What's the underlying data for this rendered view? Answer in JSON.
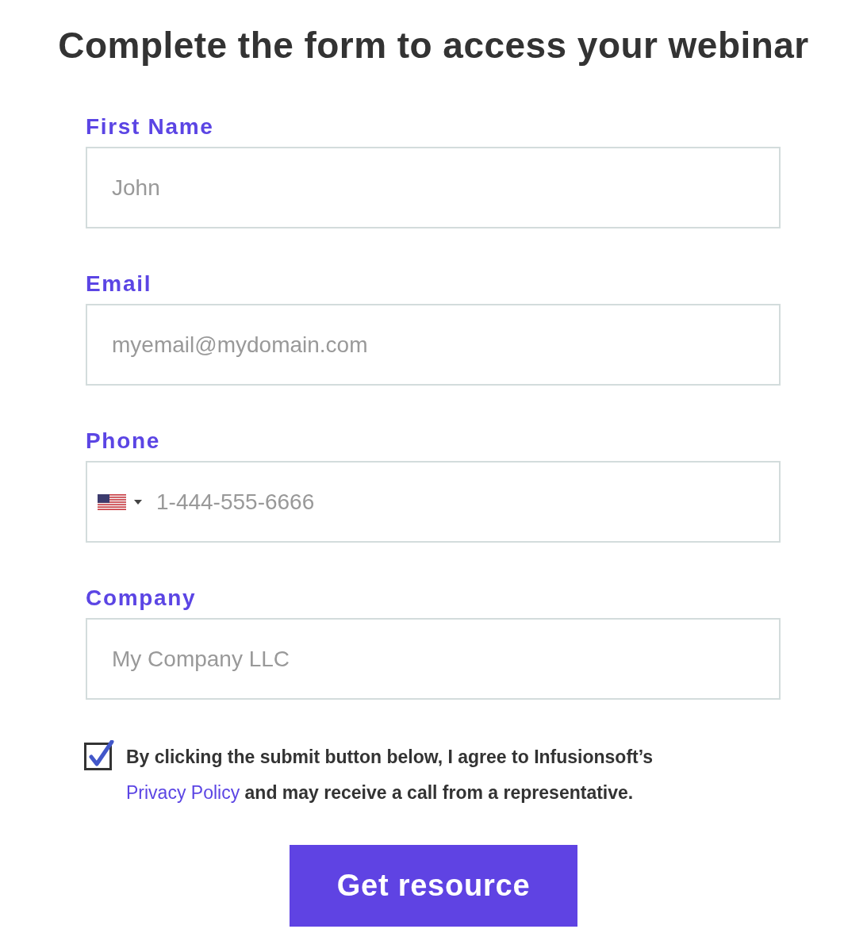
{
  "heading": "Complete the form to access your webinar",
  "fields": [
    {
      "kind": "text",
      "label": "First Name",
      "placeholder": "John"
    },
    {
      "kind": "text",
      "label": "Email",
      "placeholder": "myemail@mydomain.com"
    },
    {
      "kind": "phone",
      "label": "Phone",
      "placeholder": "1-444-555-6666"
    },
    {
      "kind": "text",
      "label": "Company",
      "placeholder": "My Company LLC"
    }
  ],
  "consent": {
    "checked": true,
    "text_before": "By clicking the submit button below, I agree to Infusionsoft’s",
    "link": "Privacy Policy",
    "text_after": "and may receive a call from a representative."
  },
  "submit": {
    "label": "Get resource"
  }
}
